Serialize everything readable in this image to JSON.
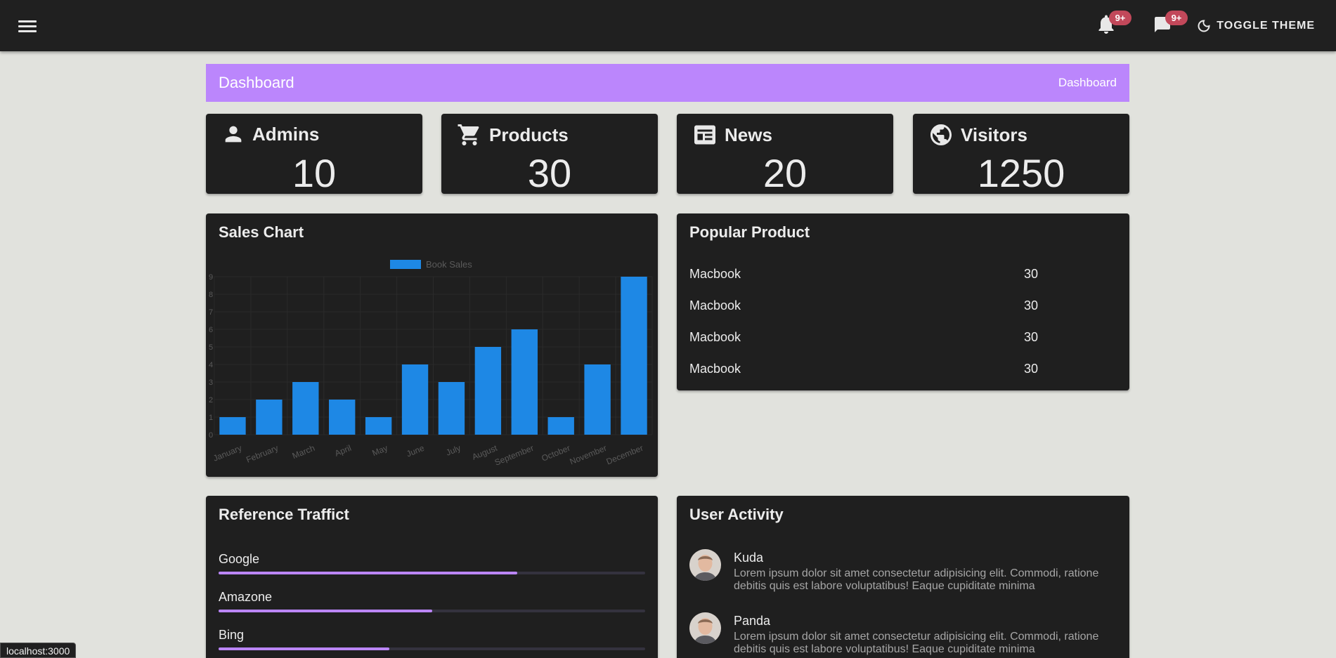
{
  "header": {
    "notification_badge": "9+",
    "message_badge": "9+",
    "toggle_theme_label": "TOGGLE THEME"
  },
  "page": {
    "title": "Dashboard",
    "breadcrumb": "Dashboard"
  },
  "stats": [
    {
      "label": "Admins",
      "value": "10",
      "icon": "person-icon"
    },
    {
      "label": "Products",
      "value": "30",
      "icon": "cart-icon"
    },
    {
      "label": "News",
      "value": "20",
      "icon": "newspaper-icon"
    },
    {
      "label": "Visitors",
      "value": "1250",
      "icon": "globe-icon"
    }
  ],
  "sales_chart": {
    "title": "Sales Chart"
  },
  "chart_data": {
    "type": "bar",
    "categories": [
      "January",
      "February",
      "March",
      "April",
      "May",
      "June",
      "July",
      "August",
      "September",
      "October",
      "November",
      "December"
    ],
    "series": [
      {
        "name": "Book Sales",
        "values": [
          1,
          2,
          3,
          2,
          1,
          4,
          3,
          5,
          6,
          1,
          4,
          9
        ]
      }
    ],
    "ylim": [
      0,
      9
    ],
    "yticks": [
      "0",
      "1",
      "2",
      "3",
      "4",
      "5",
      "6",
      "7",
      "8",
      "9"
    ],
    "grid": true,
    "legend": "top",
    "colors": {
      "bar": "#1e88e5",
      "grid": "#2a2a2a",
      "tick": "#5a5a5a"
    }
  },
  "popular_product": {
    "title": "Popular Product",
    "rows": [
      {
        "name": "Macbook",
        "qty": "30"
      },
      {
        "name": "Macbook",
        "qty": "30"
      },
      {
        "name": "Macbook",
        "qty": "30"
      },
      {
        "name": "Macbook",
        "qty": "30"
      }
    ]
  },
  "reference_traffic": {
    "title": "Reference Traffict",
    "items": [
      {
        "name": "Google",
        "percent": 70
      },
      {
        "name": "Amazone",
        "percent": 50
      },
      {
        "name": "Bing",
        "percent": 40
      }
    ]
  },
  "user_activity": {
    "title": "User Activity",
    "items": [
      {
        "name": "Kuda",
        "text": "Lorem ipsum dolor sit amet consectetur adipisicing elit. Commodi, ratione debitis quis est labore voluptatibus! Eaque cupiditate minima"
      },
      {
        "name": "Panda",
        "text": "Lorem ipsum dolor sit amet consectetur adipisicing elit. Commodi, ratione debitis quis est labore voluptatibus! Eaque cupiditate minima"
      }
    ]
  },
  "status_bar": {
    "url": "localhost:3000"
  },
  "colors": {
    "accent": "#bb86fc",
    "appbar": "#202020",
    "card": "#1f1f1f",
    "page_bg": "#e1e2dd",
    "badge": "#c2485a"
  }
}
